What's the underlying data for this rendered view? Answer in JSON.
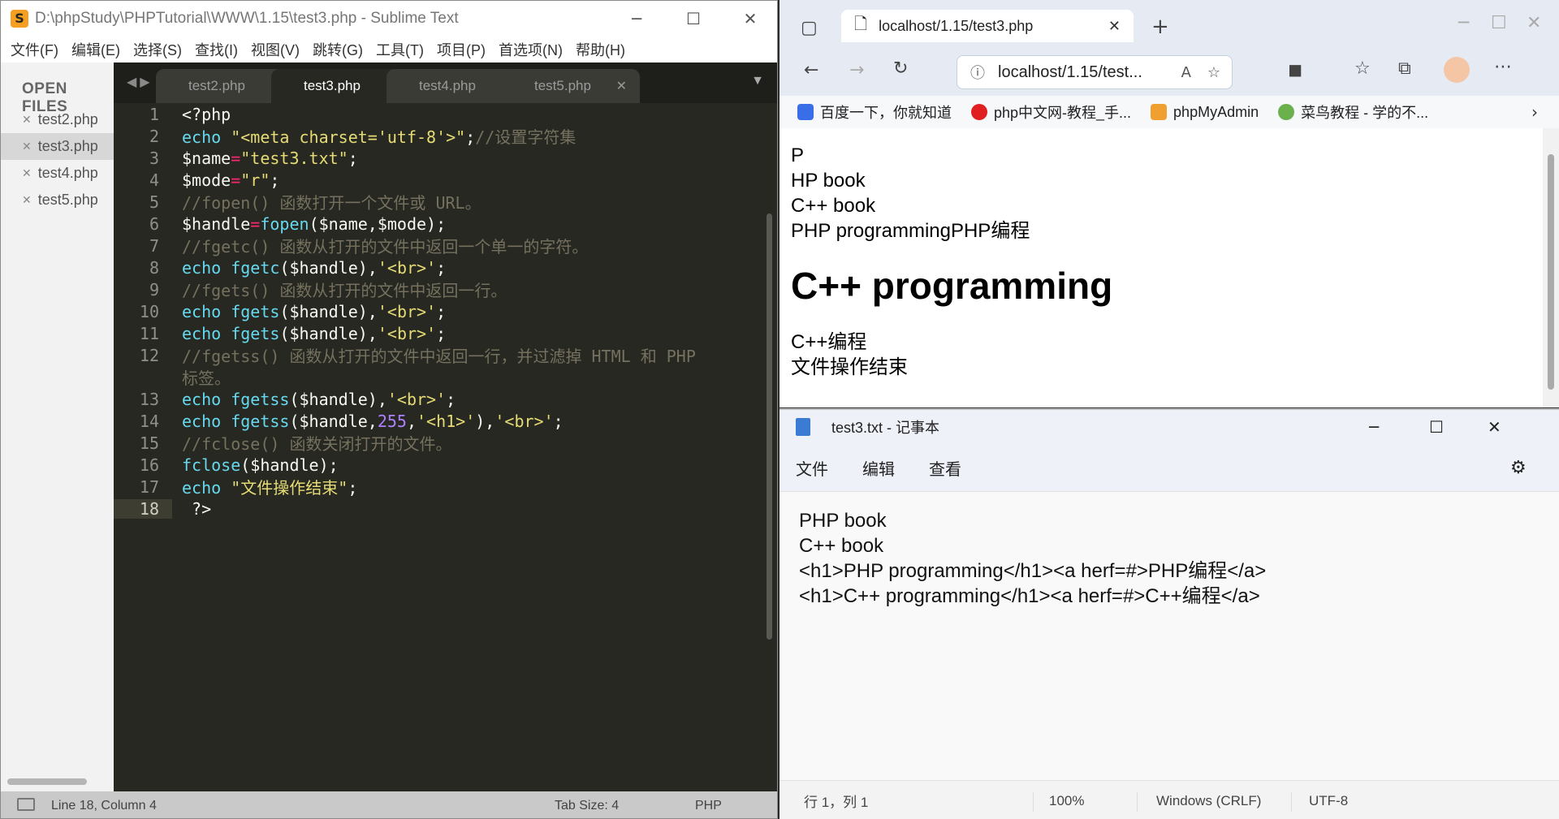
{
  "sublime": {
    "title": "D:\\phpStudy\\PHPTutorial\\WWW\\1.15\\test3.php - Sublime Text",
    "menu": [
      "文件(F)",
      "编辑(E)",
      "选择(S)",
      "查找(I)",
      "视图(V)",
      "跳转(G)",
      "工具(T)",
      "项目(P)",
      "首选项(N)",
      "帮助(H)"
    ],
    "sidebar_header": "OPEN FILES",
    "open_files": [
      "test2.php",
      "test3.php",
      "test4.php",
      "test5.php"
    ],
    "tabs": [
      "test2.php",
      "test3.php",
      "test4.php",
      "test5.php"
    ],
    "line_numbers": [
      "1",
      "2",
      "3",
      "4",
      "5",
      "6",
      "7",
      "8",
      "9",
      "10",
      "11",
      "12",
      "",
      "13",
      "14",
      "15",
      "16",
      "17",
      "18"
    ],
    "status": {
      "position": "Line 18, Column 4",
      "tab_size": "Tab Size: 4",
      "syntax": "PHP"
    }
  },
  "browser": {
    "tab_title": "localhost/1.15/test3.php",
    "address": "localhost/1.15/test...",
    "bookmarks": [
      "百度一下，你就知道",
      "php中文网-教程_手...",
      "phpMyAdmin",
      "菜鸟教程 - 学的不..."
    ],
    "page_lines_top": [
      "P",
      "HP book",
      "C++ book",
      "PHP programmingPHP编程"
    ],
    "page_heading": "C++ programming",
    "page_lines_bottom": [
      "C++编程",
      "文件操作结束"
    ]
  },
  "notepad": {
    "title": "test3.txt - 记事本",
    "menu": [
      "文件",
      "编辑",
      "查看"
    ],
    "content_lines": [
      "PHP book",
      "C++ book",
      "<h1>PHP programming</h1><a herf=#>PHP编程</a>",
      "<h1>C++ programming</h1><a herf=#>C++编程</a>"
    ],
    "status": {
      "position": "行 1，列 1",
      "zoom": "100%",
      "line_ending": "Windows (CRLF)",
      "encoding": "UTF-8"
    }
  }
}
